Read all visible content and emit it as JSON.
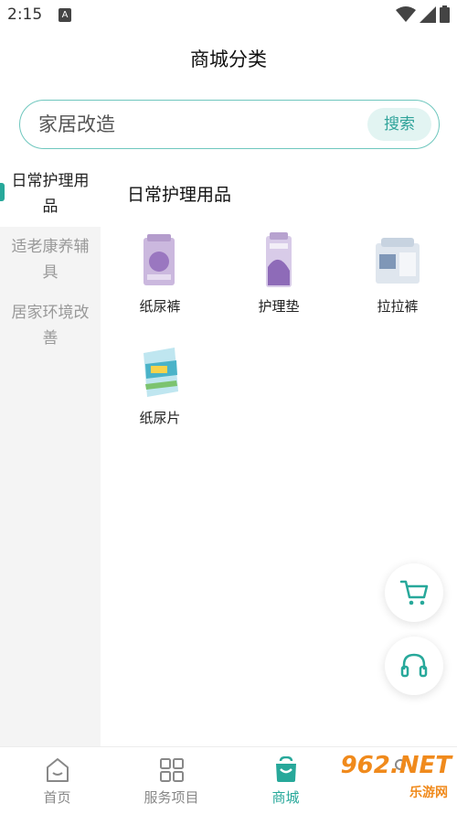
{
  "status_bar": {
    "time": "2:15",
    "notification_letter": "A"
  },
  "header": {
    "title": "商城分类"
  },
  "search": {
    "placeholder": "家居改造",
    "button_label": "搜索"
  },
  "sidebar": {
    "items": [
      {
        "label": "日常护理用品",
        "active": true
      },
      {
        "label": "适老康养辅具",
        "active": false
      },
      {
        "label": "居家环境改善",
        "active": false
      }
    ]
  },
  "main": {
    "section_title": "日常护理用品",
    "products": [
      {
        "name": "纸尿裤",
        "icon": "diaper-pack-image"
      },
      {
        "name": "护理垫",
        "icon": "nursing-pad-image"
      },
      {
        "name": "拉拉裤",
        "icon": "pull-up-pants-image"
      },
      {
        "name": "纸尿片",
        "icon": "diaper-pad-image"
      }
    ]
  },
  "floating": {
    "cart_icon": "cart-icon",
    "service_icon": "headset-icon"
  },
  "bottom_nav": {
    "items": [
      {
        "label": "首页",
        "icon": "home-icon",
        "active": false
      },
      {
        "label": "服务项目",
        "icon": "grid-icon",
        "active": false
      },
      {
        "label": "商城",
        "icon": "shop-bag-icon",
        "active": true
      },
      {
        "label": "",
        "icon": "profile-icon",
        "active": false
      }
    ]
  },
  "watermark": {
    "text": "962.NET",
    "sub": "乐游网"
  },
  "colors": {
    "accent": "#27a89a",
    "search_border": "#6fc7be",
    "search_button_bg": "#e2f4f2"
  }
}
